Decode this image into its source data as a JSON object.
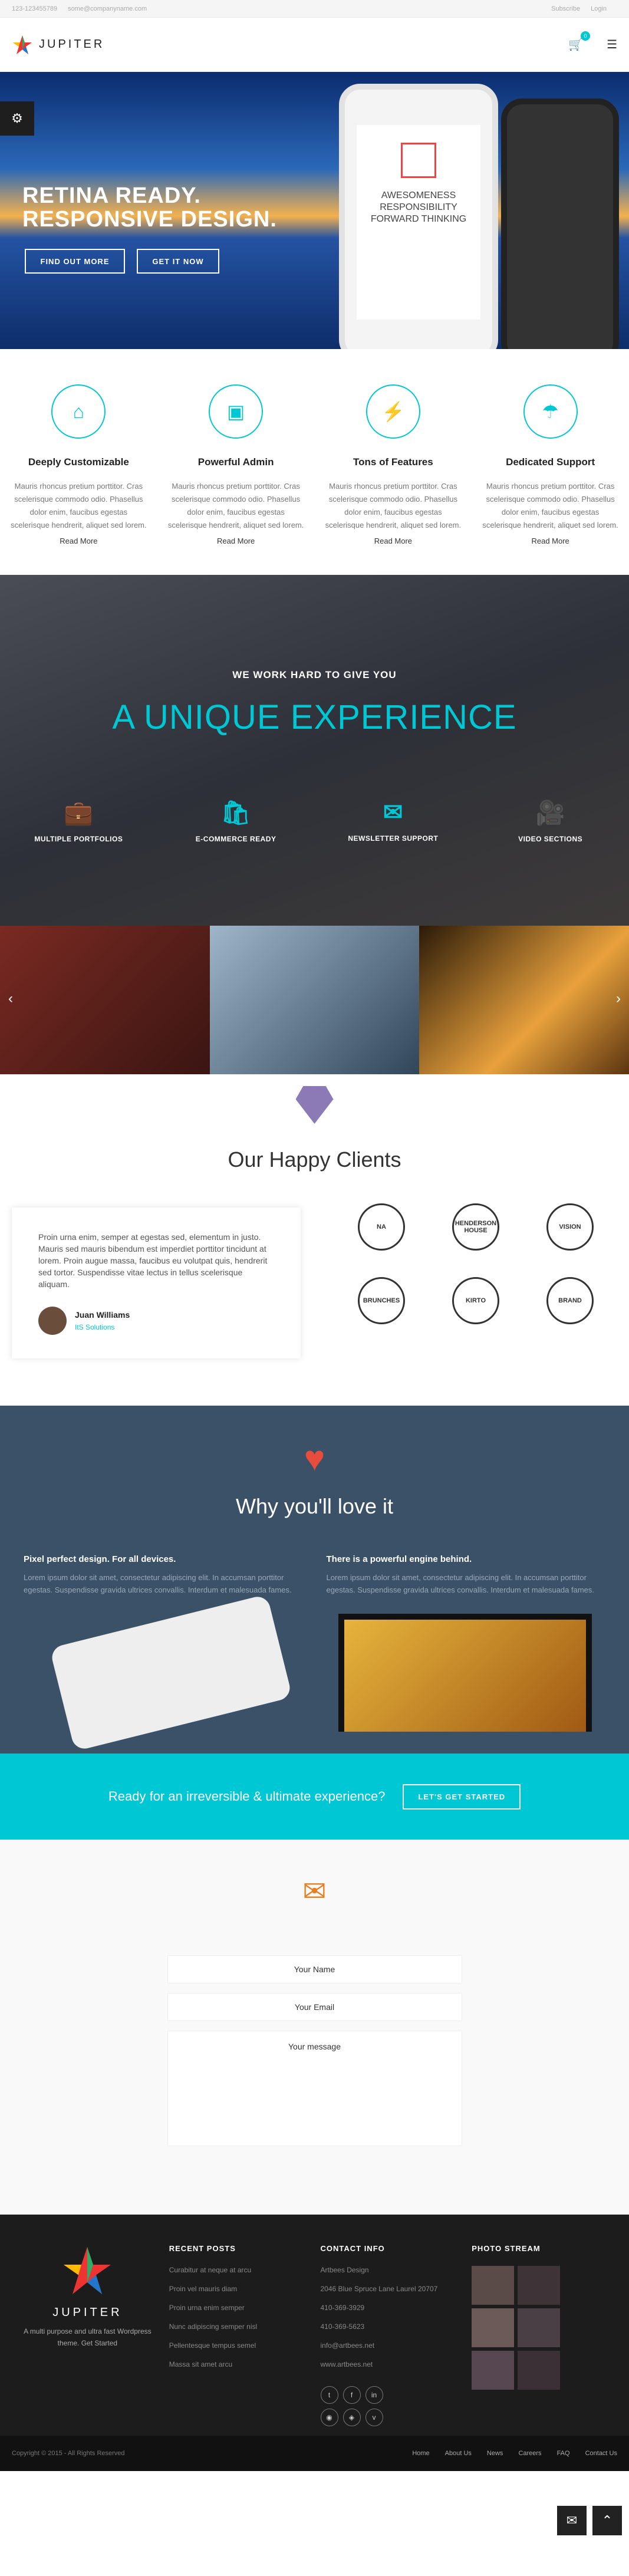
{
  "topbar": {
    "phone": "123-123455789",
    "email": "some@companyname.com",
    "subscribe": "Subscribe",
    "login": "Login"
  },
  "header": {
    "logo": "JUPITER",
    "cart_count": "0"
  },
  "hero": {
    "title_line1": "RETINA READY.",
    "title_line2": "RESPONSIVE DESIGN.",
    "btn1": "FIND OUT MORE",
    "btn2": "GET IT NOW",
    "phone_text": "AWESOMENESS RESPONSIBILITY FORWARD THINKING"
  },
  "features": [
    {
      "title": "Deeply Customizable",
      "text": "Mauris rhoncus pretium porttitor. Cras scelerisque commodo odio. Phasellus dolor enim, faucibus egestas scelerisque hendrerit, aliquet sed lorem.",
      "link": "Read More",
      "icon": "⌂"
    },
    {
      "title": "Powerful Admin",
      "text": "Mauris rhoncus pretium porttitor. Cras scelerisque commodo odio. Phasellus dolor enim, faucibus egestas scelerisque hendrerit, aliquet sed lorem.",
      "link": "Read More",
      "icon": "▣"
    },
    {
      "title": "Tons of Features",
      "text": "Mauris rhoncus pretium porttitor. Cras scelerisque commodo odio. Phasellus dolor enim, faucibus egestas scelerisque hendrerit, aliquet sed lorem.",
      "link": "Read More",
      "icon": "⚡"
    },
    {
      "title": "Dedicated Support",
      "text": "Mauris rhoncus pretium porttitor. Cras scelerisque commodo odio. Phasellus dolor enim, faucibus egestas scelerisque hendrerit, aliquet sed lorem.",
      "link": "Read More",
      "icon": "☂"
    }
  ],
  "unique": {
    "subtitle": "WE WORK HARD TO GIVE YOU",
    "title": "A UNIQUE EXPERIENCE",
    "items": [
      "MULTIPLE PORTFOLIOS",
      "E-COMMERCE READY",
      "NEWSLETTER SUPPORT",
      "VIDEO SECTIONS"
    ]
  },
  "clients": {
    "title": "Our Happy Clients",
    "quote": "Proin urna enim, semper at egestas sed, elementum in justo. Mauris sed mauris bibendum est imperdiet porttitor tincidunt at lorem. Proin augue massa, faucibus eu volutpat quis, hendrerit sed tortor. Suspendisse vitae lectus in tellus scelerisque aliquam.",
    "author": "Juan Williams",
    "company": "ItS Solutions",
    "logos": [
      "NA",
      "HENDERSON HOUSE",
      "VISION",
      "BRUNCHES",
      "KIRTO",
      "BRAND"
    ]
  },
  "love": {
    "title": "Why you'll love it",
    "col1_title": "Pixel perfect design. For all devices.",
    "col1_text": "Lorem ipsum dolor sit amet, consectetur adipiscing elit. In accumsan porttitor egestas. Suspendisse gravida ultrices convallis. Interdum et malesuada fames.",
    "col2_title": "There is a powerful engine behind.",
    "col2_text": "Lorem ipsum dolor sit amet, consectetur adipiscing elit. In accumsan porttitor egestas. Suspendisse gravida ultrices convallis. Interdum et malesuada fames."
  },
  "cta": {
    "text": "Ready for an irreversible & ultimate experience?",
    "button": "LET'S GET STARTED"
  },
  "contact": {
    "name": "Your Name",
    "email": "Your Email",
    "message": "Your message"
  },
  "footer": {
    "logo": "JUPITER",
    "tagline": "A multi purpose and ultra fast Wordpress theme. Get Started",
    "posts_title": "RECENT POSTS",
    "posts": [
      "Curabitur at neque at arcu",
      "Proin vel mauris diam",
      "Proin urna enim semper",
      "Nunc adipiscing semper nisl",
      "Pellentesque tempus semel",
      "Massa sit amet arcu"
    ],
    "contact_title": "CONTACT INFO",
    "contact": [
      "Artbees Design",
      "2046 Blue Spruce Lane Laurel 20707",
      "410-369-3929",
      "410-369-5623",
      "info@artbees.net",
      "www.artbees.net"
    ],
    "photo_title": "PHOTO STREAM"
  },
  "bottom": {
    "copyright": "Copyright © 2015 - All Rights Reserved",
    "nav": [
      "Home",
      "About Us",
      "News",
      "Careers",
      "FAQ",
      "Contact Us"
    ]
  }
}
